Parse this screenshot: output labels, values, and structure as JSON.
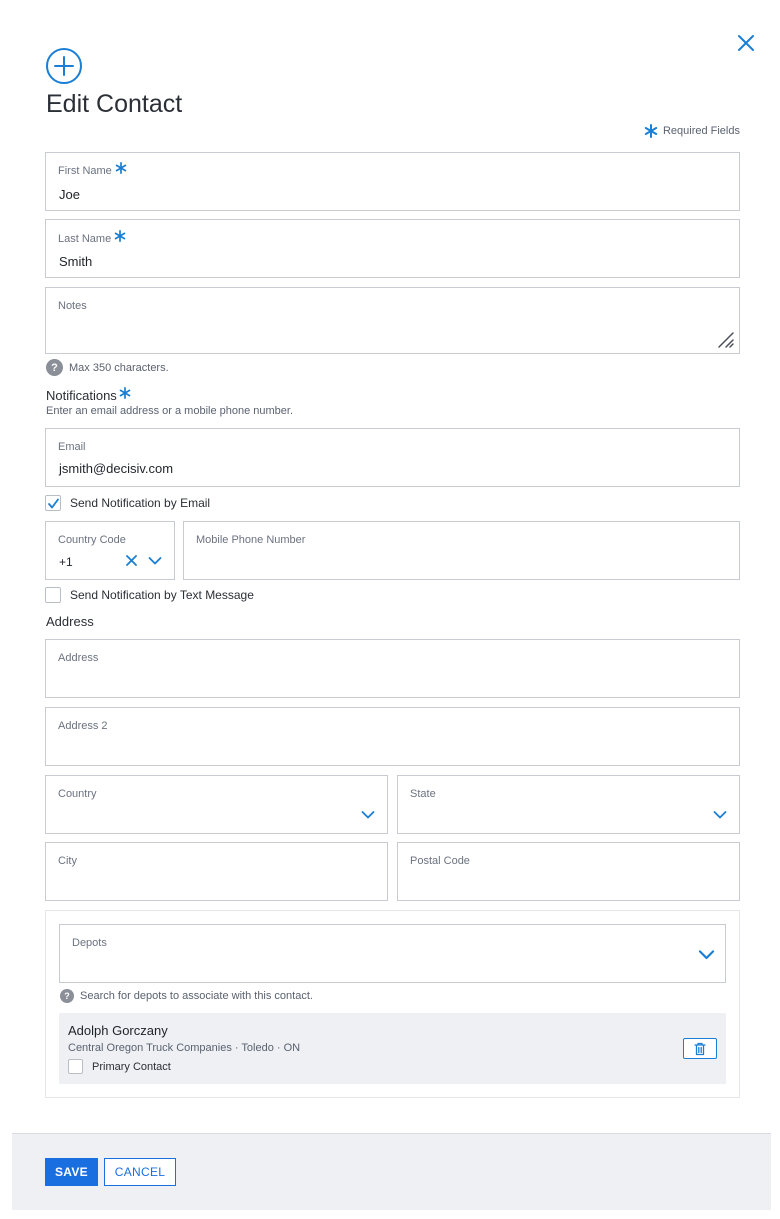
{
  "header": {
    "title": "Edit Contact",
    "required_note": "Required Fields"
  },
  "fields": {
    "first_name": {
      "label": "First Name",
      "value": "Joe"
    },
    "last_name": {
      "label": "Last Name",
      "value": "Smith"
    },
    "notes": {
      "label": "Notes",
      "value": "",
      "helper": "Max 350 characters."
    }
  },
  "notifications": {
    "title": "Notifications",
    "subtitle": "Enter an email address or a mobile phone number.",
    "email": {
      "label": "Email",
      "value": "jsmith@decisiv.com"
    },
    "send_email": {
      "label": "Send Notification by Email",
      "checked": true
    },
    "country_code": {
      "label": "Country Code",
      "value": "+1"
    },
    "mobile": {
      "label": "Mobile Phone Number",
      "value": ""
    },
    "send_text": {
      "label": "Send Notification by Text Message",
      "checked": false
    }
  },
  "address": {
    "title": "Address",
    "address1": {
      "label": "Address",
      "value": ""
    },
    "address2": {
      "label": "Address 2",
      "value": ""
    },
    "country": {
      "label": "Country",
      "value": ""
    },
    "state": {
      "label": "State",
      "value": ""
    },
    "city": {
      "label": "City",
      "value": ""
    },
    "postal": {
      "label": "Postal Code",
      "value": ""
    }
  },
  "depots": {
    "label": "Depots",
    "helper": "Search for depots to associate with this contact.",
    "items": [
      {
        "name": "Adolph Gorczany",
        "detail": "Central Oregon Truck Companies · Toledo · ON",
        "primary_label": "Primary Contact",
        "primary": false
      }
    ]
  },
  "footer": {
    "save_label": "SAVE",
    "cancel_label": "CANCEL"
  },
  "colors": {
    "accent": "#1a7fd4",
    "primary_button": "#1a6fe0",
    "border": "#c8ccd2"
  }
}
